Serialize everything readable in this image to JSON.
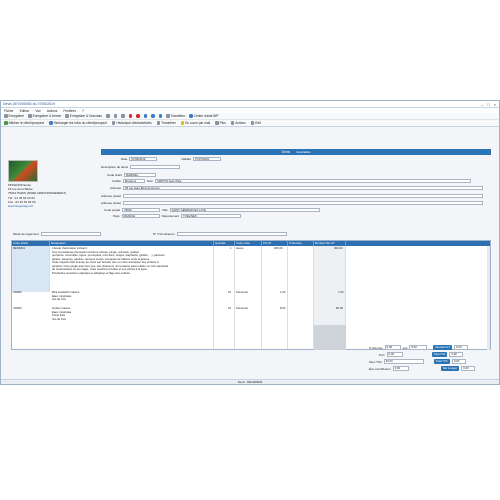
{
  "window": {
    "title": "Devis DEV000063 du 07/06/2019"
  },
  "menu": [
    "Fichier",
    "Edition",
    "Vue",
    "Actions",
    "Fenêtres",
    "?"
  ],
  "toolbar": {
    "save": "Enregistrer",
    "save_close": "Enregistrer & fermer",
    "save_new": "Enregistrer & Nouveau",
    "transfer": "Transférer",
    "print_pdf": "Centre d'aide BIP"
  },
  "toolbar2": {
    "show_prospect": "Afficher le client/prospect",
    "recharge": "Recharger les infos du client/prospect",
    "history": "Historique clients/articles",
    "transfer": "Transférer",
    "per_mail": "En cours par mail",
    "plus": "Plus",
    "actions": "Actions",
    "edit": "Edit"
  },
  "docbar": {
    "label": "Devis",
    "sub": "Généralités"
  },
  "left": {
    "company": "MISSIONS Ecole",
    "street": "18 rue de la Barbe",
    "city": "75012 PARIS (3DME ARRONDISSEMENT)",
    "tel": "Tél : 01 45 63 00 00",
    "fax": "Fax : 01 45 63 00 00",
    "web": "www.Superdepot.fr"
  },
  "form": {
    "date_label": "Date",
    "date_value": "07/06/2019",
    "validite_label": "Validité",
    "validite_value": "07/07/2019",
    "desc_label": "Description du devis",
    "code_client_label": "Code client",
    "code_client_value": "MARIDEL",
    "civilite_label": "Civilité",
    "civilite_value": "Monsieur",
    "nom_label": "Nom",
    "nom_value": "MARTIN Jean-Paul",
    "adresse_label": "Adresse",
    "adresse_value": "55 rue Jean-Bord de Dormé",
    "adresse2_label": "Adresse (suite)",
    "adresse3_label": "Adresse (suite)",
    "cp_label": "Code postal",
    "cp_value": "78100",
    "ville_label": "Ville",
    "ville_value": "SAINT GERMAIN EN LAYE",
    "pays_label": "Pays",
    "pays_value": "FRANCE",
    "dept_label": "Département",
    "dept_value": "YVELINES",
    "reglement_label": "Mode de règlement",
    "tva_label": "N° TVA intracom",
    "tva_value": ""
  },
  "grid": {
    "headers": [
      "Code article",
      "Désignation",
      "Quantité",
      "Code unité",
      "PU HT",
      "% Remise",
      "Montant Net HT"
    ],
    "rows": [
      {
        "code": "DESSIN1",
        "lines": [
          "L'Ecole d'animation incluant :",
          "Une merveilleuse décoration à thème incluse, jungle, animaux, girafes",
          "(serpents, crocodiles, tigres, perroquets, mini-lions, singes, éléphants, girafes, ...), palmiers",
          "géants, bananes, gaufres, tentures vertes, bouquets de ballons verts et jaunes.",
          "Cette superbe fête animée au choix par Scoobu doo ou notre animateur des enfants à",
          "pénétrer notre jungle avec leur jour, des chansons, de la danse sans oublier un mini spectacle",
          "de marionnettes ou de magie, notre machine à bulles et une pêche à la ligne.",
          "Prochettes surprises originales et adaptées à l'âge des enfants."
        ],
        "qte": "1",
        "unite": "Heure",
        "pu": "300,00",
        "remise": "",
        "net": "300,00"
      },
      {
        "code": "ANIM2",
        "lines": [
          "Mini sandwich maison",
          "Eaux minérales",
          "Jus de fruit"
        ],
        "qte": "10",
        "unite": "Personne",
        "pu": "1,00",
        "remise": "",
        "net": "7,00"
      },
      {
        "code": "ANIM3",
        "lines": [
          "Goûter maison",
          "Eaux minérales",
          "Fruits frais",
          "Jus de fruit"
        ],
        "qte": "10",
        "unite": "Personne",
        "pu": "8,00",
        "remise": "",
        "net": "80,00"
      }
    ]
  },
  "totals": {
    "remise_label": "% Remise",
    "remise_value": "0,00",
    "remise_suffix": "soit",
    "remise_amount": "0,00",
    "port_label": "Port",
    "port_value": "0,00",
    "escompte_label": "Escompte",
    "escompte_value": "0,00",
    "taux_label": "Taux TVA",
    "taux_value": "20,00",
    "net_label": "Montant HT",
    "net_value": "0,00",
    "tva_label": "Montant TVA",
    "tva_value": "0,00",
    "ttc_label": "Total TTC",
    "ttc_value": "0,00",
    "acompte_label": "Net à payer",
    "acompte_value": "0,00",
    "contribution_label": "Éco-contribution",
    "contribution_value": "0,00",
    "btn1": "Montant HT",
    "btn2": "Total TVA",
    "btn3": "Total TTC",
    "btn4": "Net à payer"
  },
  "status": {
    "text": "Devis : DEV000063"
  }
}
